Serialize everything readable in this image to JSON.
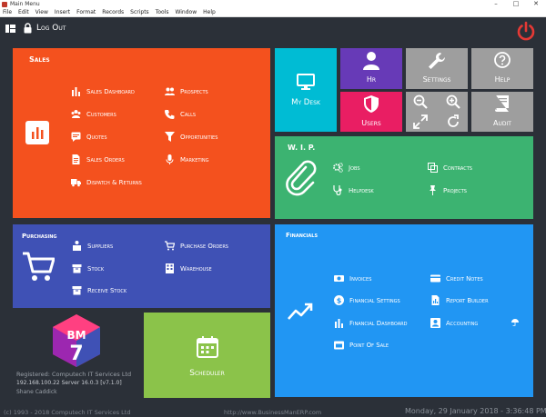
{
  "window": {
    "title": "Main Menu"
  },
  "menu": [
    "File",
    "Edit",
    "View",
    "Insert",
    "Format",
    "Records",
    "Scripts",
    "Tools",
    "Window",
    "Help"
  ],
  "toolbar": {
    "logout_label": "Log Out"
  },
  "sales": {
    "title": "Sales",
    "color": "#f4511e",
    "items": [
      {
        "label": "Sales Dashboard",
        "icon": "bar-chart-icon"
      },
      {
        "label": "Prospects",
        "icon": "people-icon"
      },
      {
        "label": "Customers",
        "icon": "group-icon"
      },
      {
        "label": "Calls",
        "icon": "phone-icon"
      },
      {
        "label": "Quotes",
        "icon": "quote-icon"
      },
      {
        "label": "Opportunities",
        "icon": "funnel-icon"
      },
      {
        "label": "Sales Orders",
        "icon": "document-icon"
      },
      {
        "label": "Marketing",
        "icon": "microphone-icon"
      },
      {
        "label": "Dispatch & Returns",
        "icon": "truck-icon"
      }
    ]
  },
  "purchasing": {
    "title": "Purchasing",
    "color": "#3f51b5",
    "items": [
      {
        "label": "Suppliers",
        "icon": "supplier-icon"
      },
      {
        "label": "Purchase Orders",
        "icon": "cart-icon"
      },
      {
        "label": "Stock",
        "icon": "box-icon"
      },
      {
        "label": "Warehouse",
        "icon": "building-icon"
      },
      {
        "label": "Receive Stock",
        "icon": "receive-box-icon"
      }
    ]
  },
  "tiles": {
    "mydesk": {
      "label": "My Desk",
      "color": "#00bcd4"
    },
    "hr": {
      "label": "Hr",
      "color": "#673ab7"
    },
    "users": {
      "label": "Users",
      "color": "#e91e63"
    },
    "settings": {
      "label": "Settings",
      "color": "#9e9e9e"
    },
    "help": {
      "label": "Help",
      "color": "#9e9e9e"
    },
    "audit": {
      "label": "Audit",
      "color": "#9e9e9e"
    },
    "scheduler": {
      "label": "Scheduler",
      "color": "#8bc34a"
    }
  },
  "wip": {
    "title": "W. I. P.",
    "color": "#3cb371",
    "items": [
      {
        "label": "Jobs",
        "icon": "gears-icon"
      },
      {
        "label": "Contracts",
        "icon": "copy-icon"
      },
      {
        "label": "Helpdesk",
        "icon": "stethoscope-icon"
      },
      {
        "label": "Projects",
        "icon": "pin-icon"
      }
    ]
  },
  "financials": {
    "title": "Financials",
    "color": "#2196f3",
    "items": [
      {
        "label": "Invoices",
        "icon": "money-icon"
      },
      {
        "label": "Credit Notes",
        "icon": "credit-card-icon"
      },
      {
        "label": "Financial Settings",
        "icon": "dollar-icon"
      },
      {
        "label": "Report Builder",
        "icon": "report-icon"
      },
      {
        "label": "Financial Dashboard",
        "icon": "bar-chart-icon"
      },
      {
        "label": "Accounting",
        "icon": "id-card-icon"
      },
      {
        "label": "Point Of Sale",
        "icon": "calendar-card-icon"
      }
    ]
  },
  "brand": {
    "logo_text": "BM",
    "logo_number": "7",
    "registered": "Registered: Computech IT Services Ltd",
    "server": "192.168.100.22 Server 16.0.3 [v7.1.0]",
    "user": "Shane Caddick"
  },
  "footer": {
    "copyright": "(c) 1993 - 2018 Computech IT Services Ltd",
    "url": "http://www.BusinessManERP.com",
    "datetime": "Monday, 29 January 2018 - 3:36:48 PM"
  }
}
